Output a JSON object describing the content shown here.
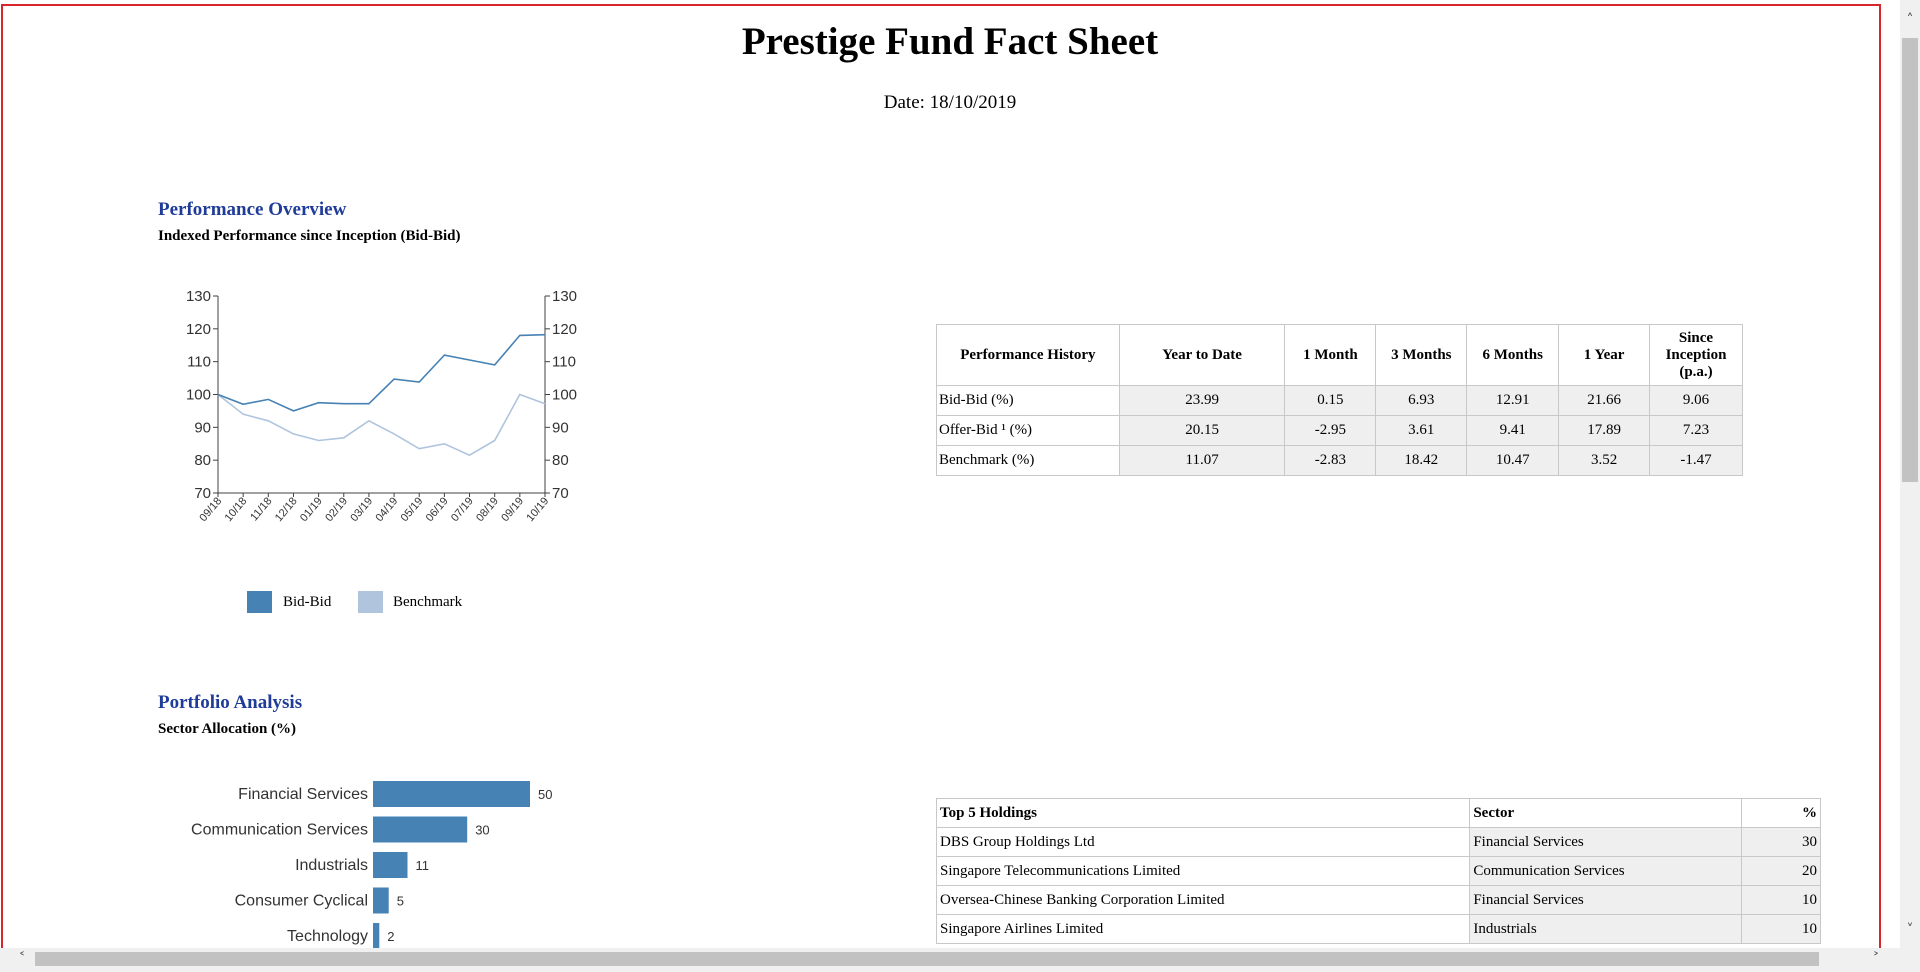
{
  "page": {
    "title": "Prestige Fund Fact Sheet",
    "date_line": "Date: 18/10/2019"
  },
  "performance": {
    "section_title": "Performance Overview",
    "subtitle": "Indexed Performance since Inception (Bid-Bid)",
    "legend": [
      {
        "label": "Bid-Bid",
        "color": "#4682b4"
      },
      {
        "label": "Benchmark",
        "color": "#b0c4de"
      }
    ]
  },
  "performance_history": {
    "columns": [
      "Performance History",
      "Year to Date",
      "1 Month",
      "3 Months",
      "6 Months",
      "1 Year",
      "Since Inception (p.a.)"
    ],
    "rows": [
      {
        "label": "Bid-Bid (%)",
        "values": [
          "23.99",
          "0.15",
          "6.93",
          "12.91",
          "21.66",
          "9.06"
        ]
      },
      {
        "label": "Offer-Bid ¹ (%)",
        "values": [
          "20.15",
          "-2.95",
          "3.61",
          "9.41",
          "17.89",
          "7.23"
        ]
      },
      {
        "label": "Benchmark (%)",
        "values": [
          "11.07",
          "-2.83",
          "18.42",
          "10.47",
          "3.52",
          "-1.47"
        ]
      }
    ]
  },
  "portfolio": {
    "section_title": "Portfolio Analysis",
    "subtitle": "Sector Allocation (%)"
  },
  "holdings": {
    "columns": [
      "Top 5 Holdings",
      "Sector",
      "%"
    ],
    "rows": [
      {
        "name": "DBS Group Holdings Ltd",
        "sector": "Financial Services",
        "pct": "30"
      },
      {
        "name": "Singapore Telecommunications Limited",
        "sector": "Communication Services",
        "pct": "20"
      },
      {
        "name": "Oversea-Chinese Banking Corporation Limited",
        "sector": "Financial Services",
        "pct": "10"
      },
      {
        "name": "Singapore Airlines Limited",
        "sector": "Industrials",
        "pct": "10"
      }
    ]
  },
  "scrollbars": {
    "up_icon": "chevron-up-icon",
    "down_icon": "chevron-down-icon",
    "left_icon": "chevron-left-icon",
    "right_icon": "chevron-right-icon"
  },
  "chart_data": [
    {
      "type": "line",
      "x": [
        "09/18",
        "10/18",
        "11/18",
        "12/18",
        "01/19",
        "02/19",
        "03/19",
        "04/19",
        "05/19",
        "06/19",
        "07/19",
        "08/19",
        "09/19",
        "10/19"
      ],
      "series": [
        {
          "name": "Bid-Bid",
          "color": "#4682b4",
          "values": [
            100,
            97,
            98.5,
            95,
            97.5,
            97.2,
            97.2,
            104.7,
            103.8,
            112,
            110.5,
            109,
            118,
            118.2
          ]
        },
        {
          "name": "Benchmark",
          "color": "#b0c4de",
          "values": [
            100,
            94,
            92,
            88,
            86,
            86.8,
            92,
            88,
            83.5,
            85,
            81.5,
            86,
            100,
            97.2
          ]
        }
      ],
      "ylim": [
        70,
        130
      ],
      "yticks": [
        70,
        80,
        90,
        100,
        110,
        120,
        130
      ],
      "title": "Indexed Performance since Inception (Bid-Bid)",
      "xlabel": "",
      "ylabel": "",
      "grid": false,
      "legend": "bottom"
    },
    {
      "type": "bar",
      "orientation": "horizontal",
      "categories": [
        "Financial Services",
        "Communication Services",
        "Industrials",
        "Consumer Cyclical",
        "Technology"
      ],
      "values": [
        50,
        30,
        11,
        5,
        2
      ],
      "color": "#4682b4",
      "title": "Sector Allocation (%)",
      "xlabel": "",
      "ylabel": ""
    }
  ]
}
